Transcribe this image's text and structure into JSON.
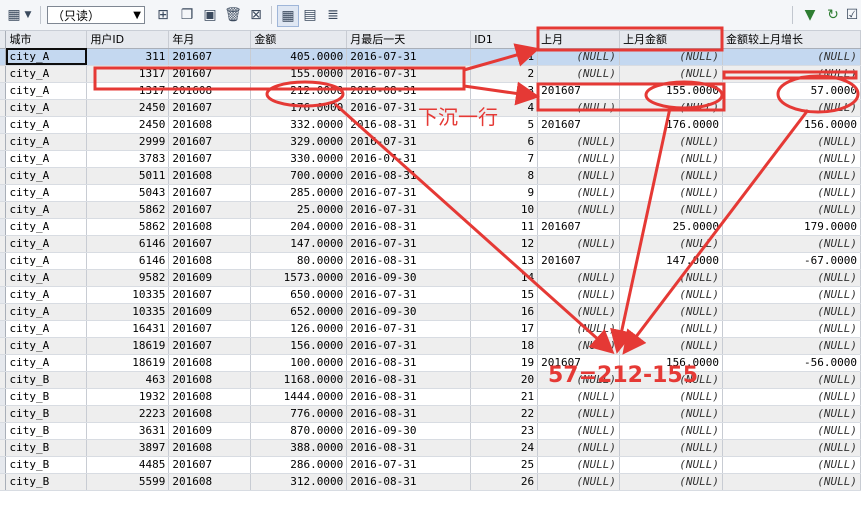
{
  "toolbar": {
    "mode_select": "（只读）",
    "icons": [
      "grid-icon",
      "add-record-icon",
      "copy-record-icon",
      "save-icon",
      "delete-icon",
      "cancel-icon",
      "grid-view-icon",
      "form-view-icon",
      "text-view-icon",
      "filter-icon",
      "refresh-icon",
      "checkbox-icon"
    ]
  },
  "grid": {
    "columns": [
      "城市",
      "用户ID",
      "年月",
      "金额",
      "月最后一天",
      "ID1",
      "上月",
      "上月金额",
      "金额较上月增长"
    ],
    "rows": [
      [
        "city_A",
        "311",
        "201607",
        "405.0000",
        "2016-07-31",
        "1",
        "(NULL)",
        "(NULL)",
        "(NULL)"
      ],
      [
        "city_A",
        "1317",
        "201607",
        "155.0000",
        "2016-07-31",
        "2",
        "(NULL)",
        "(NULL)",
        "(NULL)"
      ],
      [
        "city_A",
        "1317",
        "201608",
        "212.0000",
        "2016-08-31",
        "3",
        "201607",
        "155.0000",
        "57.0000"
      ],
      [
        "city_A",
        "2450",
        "201607",
        "176.0000",
        "2016-07-31",
        "4",
        "(NULL)",
        "(NULL)",
        "(NULL)"
      ],
      [
        "city_A",
        "2450",
        "201608",
        "332.0000",
        "2016-08-31",
        "5",
        "201607",
        "176.0000",
        "156.0000"
      ],
      [
        "city_A",
        "2999",
        "201607",
        "329.0000",
        "2016-07-31",
        "6",
        "(NULL)",
        "(NULL)",
        "(NULL)"
      ],
      [
        "city_A",
        "3783",
        "201607",
        "330.0000",
        "2016-07-31",
        "7",
        "(NULL)",
        "(NULL)",
        "(NULL)"
      ],
      [
        "city_A",
        "5011",
        "201608",
        "700.0000",
        "2016-08-31",
        "8",
        "(NULL)",
        "(NULL)",
        "(NULL)"
      ],
      [
        "city_A",
        "5043",
        "201607",
        "285.0000",
        "2016-07-31",
        "9",
        "(NULL)",
        "(NULL)",
        "(NULL)"
      ],
      [
        "city_A",
        "5862",
        "201607",
        "25.0000",
        "2016-07-31",
        "10",
        "(NULL)",
        "(NULL)",
        "(NULL)"
      ],
      [
        "city_A",
        "5862",
        "201608",
        "204.0000",
        "2016-08-31",
        "11",
        "201607",
        "25.0000",
        "179.0000"
      ],
      [
        "city_A",
        "6146",
        "201607",
        "147.0000",
        "2016-07-31",
        "12",
        "(NULL)",
        "(NULL)",
        "(NULL)"
      ],
      [
        "city_A",
        "6146",
        "201608",
        "80.0000",
        "2016-08-31",
        "13",
        "201607",
        "147.0000",
        "-67.0000"
      ],
      [
        "city_A",
        "9582",
        "201609",
        "1573.0000",
        "2016-09-30",
        "14",
        "(NULL)",
        "(NULL)",
        "(NULL)"
      ],
      [
        "city_A",
        "10335",
        "201607",
        "650.0000",
        "2016-07-31",
        "15",
        "(NULL)",
        "(NULL)",
        "(NULL)"
      ],
      [
        "city_A",
        "10335",
        "201609",
        "652.0000",
        "2016-09-30",
        "16",
        "(NULL)",
        "(NULL)",
        "(NULL)"
      ],
      [
        "city_A",
        "16431",
        "201607",
        "126.0000",
        "2016-07-31",
        "17",
        "(NULL)",
        "(NULL)",
        "(NULL)"
      ],
      [
        "city_A",
        "18619",
        "201607",
        "156.0000",
        "2016-07-31",
        "18",
        "(NULL)",
        "(NULL)",
        "(NULL)"
      ],
      [
        "city_A",
        "18619",
        "201608",
        "100.0000",
        "2016-08-31",
        "19",
        "201607",
        "156.0000",
        "-56.0000"
      ],
      [
        "city_B",
        "463",
        "201608",
        "1168.0000",
        "2016-08-31",
        "20",
        "(NULL)",
        "(NULL)",
        "(NULL)"
      ],
      [
        "city_B",
        "1932",
        "201608",
        "1444.0000",
        "2016-08-31",
        "21",
        "(NULL)",
        "(NULL)",
        "(NULL)"
      ],
      [
        "city_B",
        "2223",
        "201608",
        "776.0000",
        "2016-08-31",
        "22",
        "(NULL)",
        "(NULL)",
        "(NULL)"
      ],
      [
        "city_B",
        "3631",
        "201609",
        "870.0000",
        "2016-09-30",
        "23",
        "(NULL)",
        "(NULL)",
        "(NULL)"
      ],
      [
        "city_B",
        "3897",
        "201608",
        "388.0000",
        "2016-08-31",
        "24",
        "(NULL)",
        "(NULL)",
        "(NULL)"
      ],
      [
        "city_B",
        "4485",
        "201607",
        "286.0000",
        "2016-07-31",
        "25",
        "(NULL)",
        "(NULL)",
        "(NULL)"
      ],
      [
        "city_B",
        "5599",
        "201608",
        "312.0000",
        "2016-08-31",
        "26",
        "(NULL)",
        "(NULL)",
        "(NULL)"
      ]
    ]
  },
  "annotations": {
    "shift_label": "下沉一行",
    "formula_label": "57=212-155",
    "color": "#e53935"
  }
}
